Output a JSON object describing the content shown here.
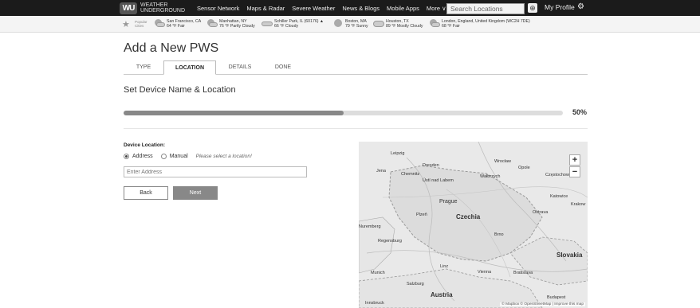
{
  "header": {
    "logo_text_line1": "WEATHER",
    "logo_text_line2": "UNDERGROUND",
    "logo_mark": "WU",
    "nav": [
      "Sensor Network",
      "Maps & Radar",
      "Severe Weather",
      "News & Blogs",
      "Mobile Apps",
      "More ∨"
    ],
    "search_placeholder": "Search Locations",
    "locate_icon": "⊕",
    "profile_label": "My Profile",
    "gear_icon": "⚙"
  },
  "citybar": {
    "star_icon": "★",
    "popular_label": "Popular Cities",
    "cities": [
      {
        "name": "San Francisco, CA",
        "weather": "64 °F Fair"
      },
      {
        "name": "Manhattan, NY",
        "weather": "76 °F Partly Cloudy"
      },
      {
        "name": "Schiller Park, IL (60176) ▲",
        "weather": "66 °F Cloudy"
      },
      {
        "name": "Boston, MA",
        "weather": "79 °F Sunny"
      },
      {
        "name": "Houston, TX",
        "weather": "89 °F Mostly Cloudy"
      },
      {
        "name": "London, England, United Kingdom (WC2H 7DE)",
        "weather": "68 °F Fair"
      }
    ]
  },
  "page": {
    "title": "Add a New PWS",
    "tabs": [
      "TYPE",
      "LOCATION",
      "DETAILS",
      "DONE"
    ],
    "active_tab": "LOCATION",
    "section_title": "Set Device Name & Location",
    "progress_percent": 50,
    "progress_label": "50%"
  },
  "form": {
    "device_location_label": "Device Location:",
    "radio_address": "Address",
    "radio_manual": "Manual",
    "hint": "Please select a location!",
    "address_placeholder": "Enter Address",
    "back_label": "Back",
    "next_label": "Next"
  },
  "map": {
    "zoom_in": "+",
    "zoom_out": "−",
    "attribution": "© Mapbox © OpenStreetMap | Improve this map",
    "places": [
      "Leipzig",
      "Dresden",
      "Wrocław",
      "Jena",
      "Chemnitz",
      "Ústí nad Labem",
      "Wałbrzych",
      "Częstochowa",
      "Katowice",
      "Ostrava",
      "Krakow",
      "Prague",
      "Plzeň",
      "Brno",
      "Regensburg",
      "Linz",
      "Vienna",
      "Bratislava",
      "Munich",
      "Salzburg",
      "Budapest",
      "Innsbruck",
      "Nuremberg",
      "Opole"
    ],
    "countries": [
      "Czechia",
      "Slovakia",
      "Austria"
    ]
  }
}
